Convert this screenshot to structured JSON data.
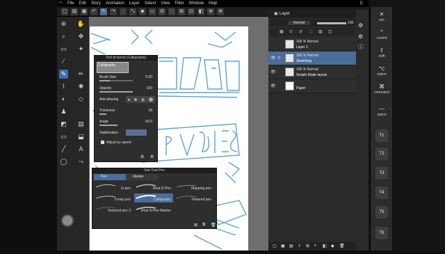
{
  "menu": {
    "items": [
      "File",
      "Edit",
      "Story",
      "Animation",
      "Layer",
      "Select",
      "View",
      "Filter",
      "Window",
      "Help"
    ]
  },
  "layer_panel": {
    "title": "Layer",
    "blend_mode": "Normal",
    "opacity": "100",
    "layers": [
      {
        "percent": "100 %",
        "mode": "Normal",
        "name": "Layer 1",
        "selected": false
      },
      {
        "percent": "100 %",
        "mode": "Normal",
        "name": "Sketching",
        "selected": true
      },
      {
        "percent": "100 %",
        "mode": "Normal",
        "name": "Simple Mode layout",
        "selected": false
      },
      {
        "percent": "",
        "mode": "",
        "name": "Paper",
        "selected": false
      }
    ]
  },
  "tool_property": {
    "title": "Tool property [Calligraphy]",
    "subtitle": "Calligraphy",
    "brush_size": {
      "label": "Brush Size",
      "value": "5.00"
    },
    "opacity": {
      "label": "Opacity",
      "value": "100"
    },
    "anti_aliasing": {
      "label": "Anti-aliasing"
    },
    "thickness": {
      "label": "Thickness",
      "value": "18"
    },
    "angle": {
      "label": "Angle",
      "value": "60.0"
    },
    "stabilization": {
      "label": "Stabilization"
    },
    "adjust_by_speed": "Adjust by speed"
  },
  "sub_tool": {
    "title": "Sub Tool Pen",
    "tabs": [
      "Pen",
      "Marker"
    ],
    "items": [
      "G-pen",
      "Real G-Pen",
      "Mapping pen",
      "Turnip pen",
      "Calligraphy",
      "Textured pen",
      "Textured pen 2",
      "Real G-Pen Marker"
    ]
  },
  "right_panel": {
    "items": [
      {
        "glyph": "✕",
        "label": "esc"
      },
      {
        "glyph": "⌃",
        "label": "control"
      },
      {
        "glyph": "⇧",
        "label": "shift"
      },
      {
        "glyph": "⌥",
        "label": "option"
      },
      {
        "glyph": "⌘",
        "label": "command"
      },
      {
        "glyph": "—",
        "label": "space"
      }
    ],
    "buttons": [
      "T1",
      "T2",
      "T3",
      "T4",
      "T5",
      "T6"
    ]
  },
  "colors": {
    "accent": "#3f6fa8",
    "sketch_blue": "#3a93d0"
  }
}
